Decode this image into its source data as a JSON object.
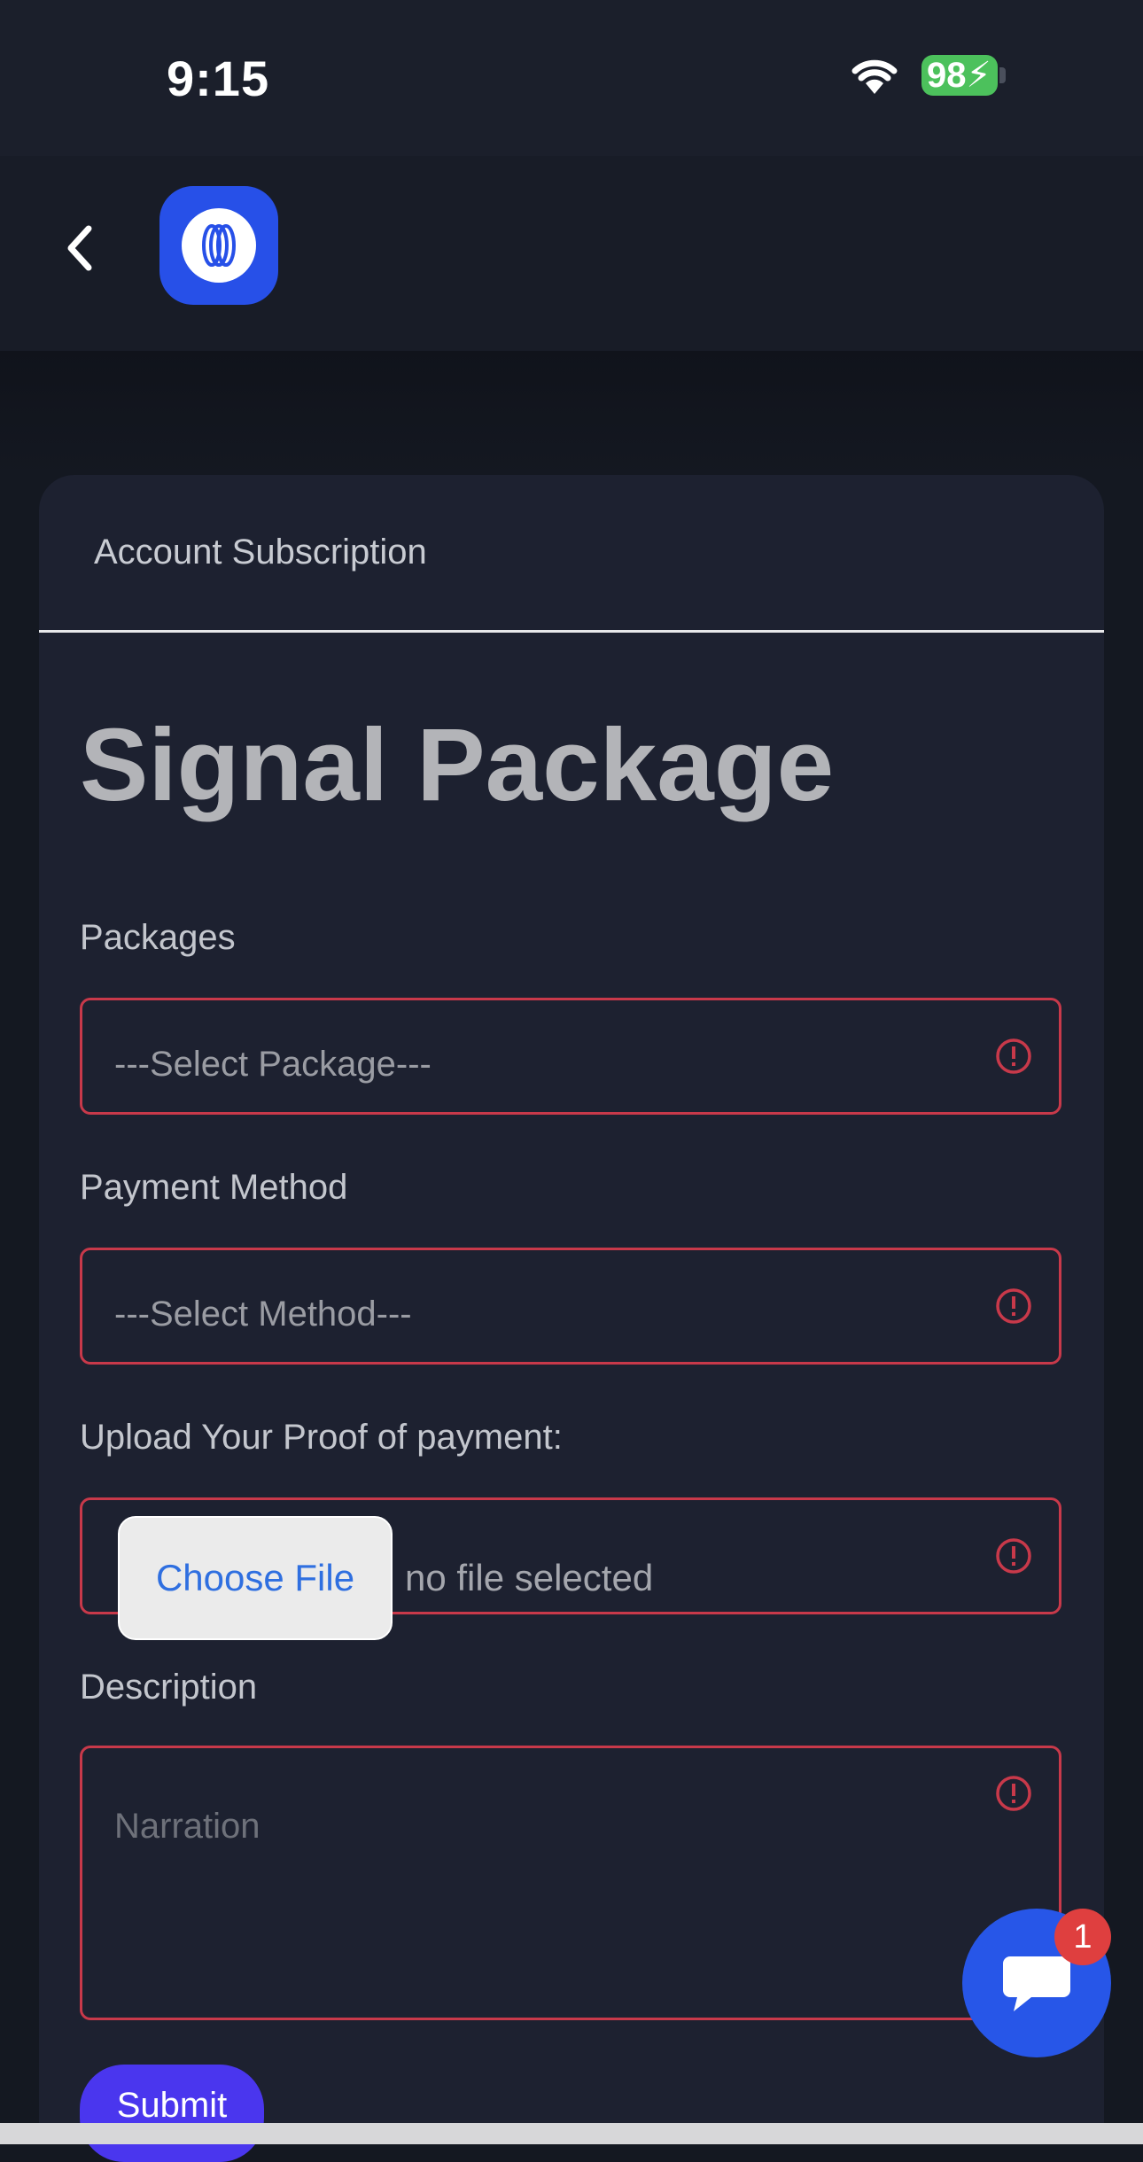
{
  "status_bar": {
    "time": "9:15",
    "battery": "98"
  },
  "header": {
    "back_icon": "chevron-left-icon",
    "logo_icon": "brand-logo"
  },
  "card": {
    "header_title": "Account Subscription",
    "page_title": "Signal Package"
  },
  "form": {
    "packages_label": "Packages",
    "packages_placeholder": "---Select Package---",
    "payment_label": "Payment Method",
    "payment_placeholder": "---Select Method---",
    "upload_label": "Upload Your Proof of payment:",
    "choose_file_label": "Choose File",
    "file_status": "no file selected",
    "description_label": "Description",
    "description_placeholder": "Narration",
    "submit_label": "Submit"
  },
  "chat": {
    "badge_count": "1"
  },
  "colors": {
    "error": "#c8394a",
    "brand": "#2750e8",
    "submit": "#4a36ee"
  }
}
